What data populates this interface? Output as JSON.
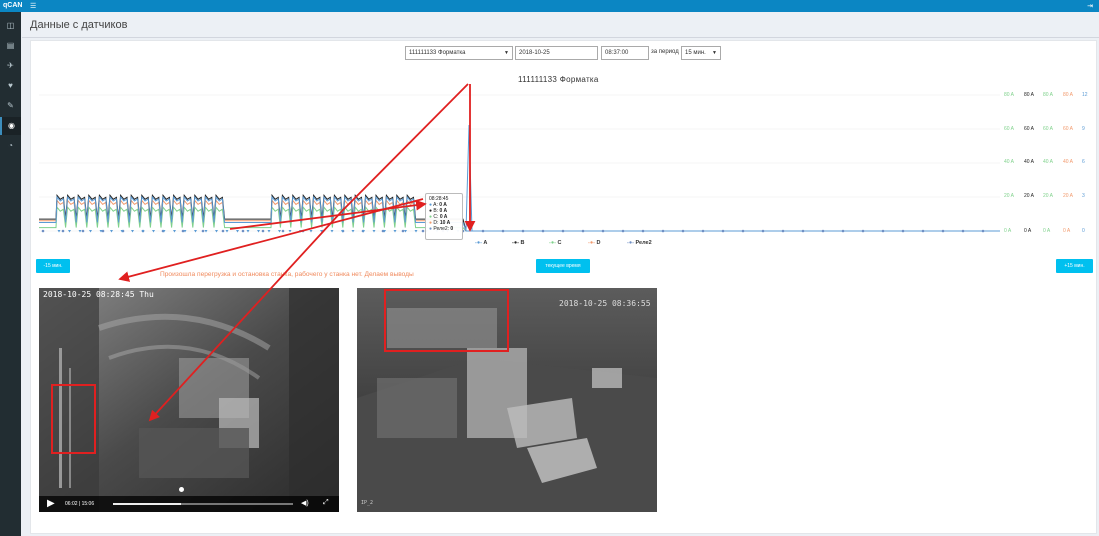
{
  "topbar": {
    "logo": "qCAN",
    "menu_icon": "bars-icon",
    "exit_icon": "logout-icon"
  },
  "sidebar": {
    "items": [
      {
        "icon": "dashboard-icon",
        "glyph": "◫",
        "active": false
      },
      {
        "icon": "document-icon",
        "glyph": "▤",
        "active": false
      },
      {
        "icon": "rocket-icon",
        "glyph": "✈",
        "active": false
      },
      {
        "icon": "heart-icon",
        "glyph": "♥",
        "active": false
      },
      {
        "icon": "wrench-icon",
        "glyph": "✎",
        "active": false
      },
      {
        "icon": "eye-icon",
        "glyph": "◉",
        "active": true
      },
      {
        "icon": "gauge-icon",
        "glyph": "◔",
        "active": false
      }
    ]
  },
  "page": {
    "title": "Данные с датчиков"
  },
  "filters": {
    "machine": "111111133 Форматка",
    "date": "2018-10-25",
    "time": "08:37:00",
    "period_label": "за период",
    "period": "15 мин."
  },
  "chart_data": {
    "type": "line",
    "title": "111111133 Форматка",
    "series": [
      {
        "name": "A",
        "color": "#5b9bd5"
      },
      {
        "name": "B",
        "color": "#222222"
      },
      {
        "name": "C",
        "color": "#7fd18b"
      },
      {
        "name": "D",
        "color": "#f29a6d"
      },
      {
        "name": "Реле2",
        "color": "#6f8fc4"
      }
    ],
    "y_axes": [
      {
        "color": "#7fd18b",
        "ticks": [
          "80 A",
          "60 A",
          "40 A",
          "20 A",
          "0 A"
        ]
      },
      {
        "color": "#222222",
        "ticks": [
          "80 A",
          "60 A",
          "40 A",
          "20 A",
          "0 A"
        ]
      },
      {
        "color": "#7fd18b",
        "ticks": [
          "80 A",
          "60 A",
          "40 A",
          "20 A",
          "0 A"
        ]
      },
      {
        "color": "#f29a6d",
        "ticks": [
          "80 A",
          "60 A",
          "40 A",
          "20 A",
          "0 A"
        ]
      },
      {
        "color": "#5b9bd5",
        "ticks": [
          "12",
          "9",
          "6",
          "3",
          "0"
        ]
      }
    ],
    "ylim": [
      0,
      80
    ],
    "cycles": {
      "group1": 16,
      "group2": 14,
      "peak_A": 12,
      "base_A": 3
    },
    "tooltip": {
      "time": "08:28:45",
      "rows": [
        {
          "label": "A:",
          "value": "0 A",
          "color": "#5b9bd5"
        },
        {
          "label": "B:",
          "value": "0 A",
          "color": "#222222"
        },
        {
          "label": "C:",
          "value": "0 A",
          "color": "#7fd18b"
        },
        {
          "label": "D:",
          "value": "10 A",
          "color": "#f29a6d"
        },
        {
          "label": "Реле2:",
          "value": "0",
          "color": "#6f8fc4"
        }
      ]
    }
  },
  "nav": {
    "prev": "-15 мин.",
    "current": "текущее время",
    "next": "+15 мин."
  },
  "annotation": "Произошла перегрузка и остановка станка, рабочего у станка нет. Делаем выводы",
  "video1": {
    "timestamp": "2018-10-25 08:28:45 Thu",
    "time": "06:02 | 15:06",
    "progress": 0.38
  },
  "video2": {
    "timestamp": "2018-10-25 08:36:55",
    "corner": "IP_2"
  },
  "colors": {
    "accent": "#0b86c3",
    "button": "#00c0ef",
    "marker": "#e02020",
    "annotation": "#f08a5d"
  }
}
